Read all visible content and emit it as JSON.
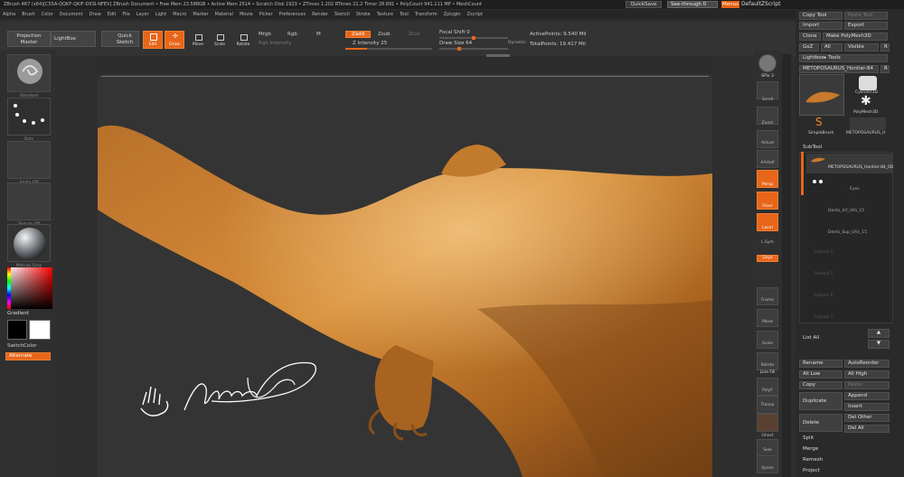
{
  "titlebar": {
    "title": "ZBrush 4R7 (x64)[CS5A-QQKF-QKIF-DXSI-NFEV]   ZBrush Document   •  Free Mem 23.588GB  •  Active Mem 2514  •  Scratch Disk 1923  •  ZTimes 1.202  RTimes 21.2  Timer 28.891  •  PolyCount 941.111 MP  •  MeshCount",
    "quicksave": "QuickSave",
    "see_through": "See-through  0",
    "menus": "Menus",
    "default_script": "DefaultZScript"
  },
  "menubar": [
    "Alpha",
    "Brush",
    "Color",
    "Document",
    "Draw",
    "Edit",
    "File",
    "Layer",
    "Light",
    "Macro",
    "Marker",
    "Material",
    "Movie",
    "Picker",
    "Preferences",
    "Render",
    "Stencil",
    "Stroke",
    "Texture",
    "Tool",
    "Transform",
    "Zplugin",
    "Zscript"
  ],
  "shelf": {
    "projection_master": "Projection Master",
    "lightbox": "LightBox",
    "quick_sketch": "Quick Sketch",
    "edit": "Edit",
    "draw": "Draw",
    "move": "Move",
    "scale": "Scale",
    "rotate": "Rotate",
    "mrgb": "Mrgb",
    "rgb": "Rgb",
    "m": "M",
    "rgb_intensity": "Rgb Intensity",
    "zadd": "Zadd",
    "zsub": "Zsub",
    "zcut": "Zcut",
    "z_intensity": "Z Intensity 25",
    "focal_shift": "Focal Shift 0",
    "draw_size": "Draw Size 64",
    "dynamic": "Dynamic",
    "active_points": "ActivePoints: 9.540  Mil",
    "total_points": "TotalPoints: 19.417  Mil"
  },
  "left_tray": {
    "brush": "Standard",
    "stroke": "Dots",
    "alpha": "Alpha Off",
    "texture": "Texture Off",
    "material": "Matcap Gray",
    "gradient": "Gradient",
    "switch_color": "SwitchColor",
    "alternate": "Alternate"
  },
  "signature": "Marc Boulay",
  "right_tools": [
    "BPR",
    "SPix 3",
    "Scroll",
    "Zoom",
    "Actual",
    "AAHalf",
    "Persp",
    "Floor",
    "Local",
    "L.Sym",
    "Gxyz",
    "Frame",
    "Move",
    "Scale",
    "Rotate",
    "Line Fill",
    "PolyF",
    "Transp",
    "Ghost",
    "Solo",
    "Xpose"
  ],
  "right_panel": {
    "copy_tool": "Copy Tool",
    "paste_tool": "Paste Tool",
    "import": "Import",
    "export": "Export",
    "clone": "Clone",
    "make_polymesh": "Make PolyMesh3D",
    "goz": "GoZ",
    "all": "All",
    "visible": "Visible",
    "r": "R",
    "lightbox_tools": "Lightbox▸ Tools",
    "current_tool": "METOPOSAURUS_Hontier-84",
    "r2": "R",
    "tool_thumbs": [
      "Cylinder3D",
      "PolyMesh3D",
      "SimpleBrush",
      "METOPOSAURUS_H"
    ],
    "subtool_header": "SubTool",
    "subtools": [
      "METOPOSAURUS_Hontier-84_0D",
      "Eyes",
      "Dents_Inf_UVs_15",
      "Dents_Sup_UVs_15",
      "Subtool 4",
      "Subtool 5",
      "Subtool 6",
      "Subtool 7"
    ],
    "list_all": "List All",
    "rename": "Rename",
    "auto_reorder": "AutoReorder",
    "all_low": "All Low",
    "all_high": "All High",
    "copy": "Copy",
    "paste": "Paste",
    "duplicate": "Duplicate",
    "append": "Append",
    "insert": "Insert",
    "delete": "Delete",
    "del_other": "Del Other",
    "del_all": "Del All",
    "split": "Split",
    "merge": "Merge",
    "remesh": "Remesh",
    "project": "Project"
  },
  "colors": {
    "accent": "#e8661a",
    "panel": "#2a2a2a",
    "canvas": "#343434"
  }
}
